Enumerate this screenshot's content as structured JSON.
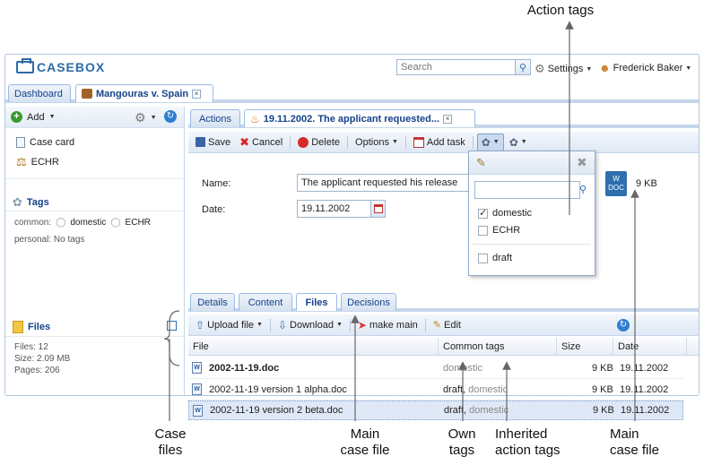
{
  "header": {
    "logo_text": "CASEBOX",
    "search_placeholder": "Search",
    "settings_label": "Settings",
    "user_name": "Frederick Baker"
  },
  "tabs": [
    {
      "label": "Dashboard"
    },
    {
      "label": "Mangouras v. Spain"
    }
  ],
  "left": {
    "add_label": "Add",
    "items": [
      {
        "label": "Case card",
        "icon": "card-icon"
      },
      {
        "label": "ECHR",
        "icon": "scales-icon"
      }
    ],
    "tags_title": "Tags",
    "tags_common_label": "common:",
    "tags_common": [
      "domestic",
      "ECHR"
    ],
    "tags_personal": "personal: No tags",
    "files_title": "Files",
    "files_stats": [
      "Files: 12",
      "Size: 2.09 MB",
      "Pages: 206"
    ]
  },
  "right": {
    "subtabs": [
      {
        "label": "Actions"
      },
      {
        "label": "19.11.2002. The applicant requested..."
      }
    ],
    "toolbar": {
      "save": "Save",
      "cancel": "Cancel",
      "delete": "Delete",
      "options": "Options",
      "add_task": "Add task"
    },
    "form": {
      "name_label": "Name:",
      "name_value": "The applicant requested his release",
      "date_label": "Date:",
      "date_value": "19.11.2002",
      "doc_size": "9 KB"
    },
    "detail_tabs": [
      "Details",
      "Content",
      "Files",
      "Decisions"
    ],
    "files_toolbar": {
      "upload": "Upload file",
      "download": "Download",
      "make_main": "make main",
      "edit": "Edit"
    },
    "grid": {
      "headers": [
        "File",
        "Common tags",
        "Size",
        "Date"
      ],
      "rows": [
        {
          "file": "2002-11-19.doc",
          "own_tag": "",
          "inherited_tag": "domestic",
          "size": "9 KB",
          "date": "19.11.2002",
          "bold": true
        },
        {
          "file": "2002-11-19 version 1 alpha.doc",
          "own_tag": "draft",
          "inherited_tag": "domestic",
          "size": "9 KB",
          "date": "19.11.2002",
          "bold": false
        },
        {
          "file": "2002-11-19 version 2 beta.doc",
          "own_tag": "draft",
          "inherited_tag": "domestic",
          "size": "9 KB",
          "date": "19.11.2002",
          "bold": false
        }
      ]
    }
  },
  "tag_dropdown": {
    "options": [
      {
        "label": "domestic",
        "checked": true
      },
      {
        "label": "ECHR",
        "checked": false
      },
      {
        "label": "draft",
        "checked": false
      }
    ]
  },
  "annotations": {
    "action_tags": "Action tags",
    "case_files": [
      "Case",
      "files"
    ],
    "main_case_file_1": [
      "Main",
      "case file"
    ],
    "own_tags": [
      "Own",
      "tags"
    ],
    "inherited_action_tags": [
      "Inherited",
      "action tags"
    ],
    "main_case_file_2": [
      "Main",
      "case file"
    ]
  },
  "colors": {
    "accent": "#15428b",
    "brand": "#2c6aa8",
    "panel_border": "#99bbe8",
    "selected_row": "#dfe8f6"
  }
}
